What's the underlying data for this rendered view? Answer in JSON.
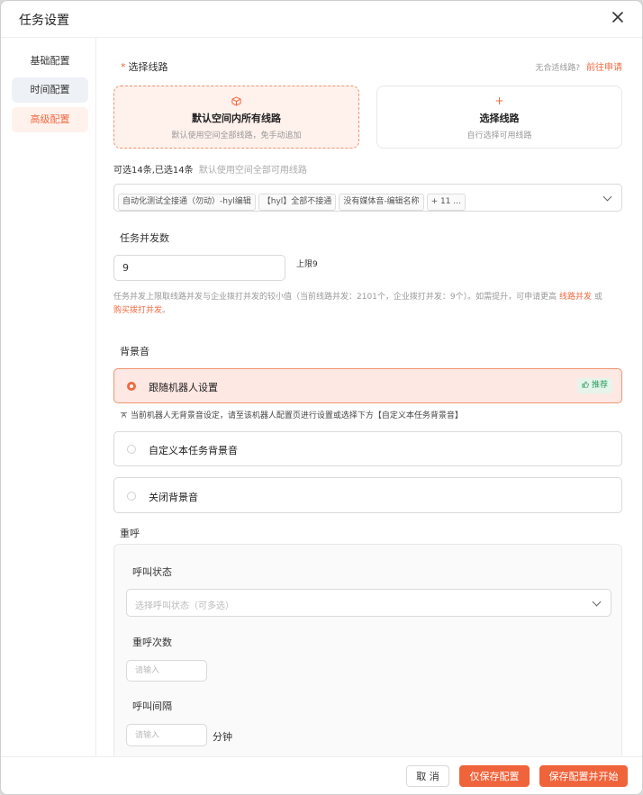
{
  "dialog": {
    "title": "任务设置"
  },
  "sidebar": {
    "items": [
      {
        "label": "基础配置"
      },
      {
        "label": "时间配置"
      },
      {
        "label": "高级配置"
      }
    ]
  },
  "lines": {
    "label": "选择线路",
    "no_fit": "无合适线路?",
    "apply_link": "前往申请",
    "card_all": {
      "title": "默认空间内所有线路",
      "desc": "默认使用空间全部线路，免手动追加"
    },
    "card_select": {
      "icon": "+",
      "title": "选择线路",
      "desc": "自行选择可用线路"
    },
    "count_text": "可选14条,已选14条",
    "count_hint": "默认使用空间全部可用线路",
    "tags": [
      "自动化测试全接通（勿动）-hyl编辑",
      "【hyl】全部不接通",
      "没有媒体音-编辑名称",
      "+ 11 ..."
    ]
  },
  "concurrency": {
    "label": "任务并发数",
    "value": "9",
    "limit": "上限9",
    "hint_prefix": "任务并发上限取线路并发与企业拨打并发的较小值（当前线路并发：2101个，企业拨打并发：9个）。如需提升，可申请更高",
    "hint_link1": "线路并发",
    "hint_or": "或",
    "hint_link2": "购买拨打并发",
    "hint_end": "。"
  },
  "bg_sound": {
    "label": "背景音",
    "options": [
      {
        "label": "跟随机器人设置",
        "selected": true,
        "badge": "推荐"
      },
      {
        "label": "自定义本任务背景音",
        "selected": false
      },
      {
        "label": "关闭背景音",
        "selected": false
      }
    ],
    "notice": "当前机器人无背景音设定，请至该机器人配置页进行设置或选择下方【自定义本任务背景音】"
  },
  "redial": {
    "label": "重呼",
    "call_status": {
      "label": "呼叫状态",
      "placeholder": "选择呼叫状态（可多选）"
    },
    "times": {
      "label": "重呼次数",
      "placeholder": "请输入"
    },
    "interval": {
      "label": "呼叫间隔",
      "placeholder": "请输入",
      "unit": "分钟"
    }
  },
  "footer": {
    "cancel": "取 消",
    "save_only": "仅保存配置",
    "save_start": "保存配置并开始"
  },
  "colors": {
    "accent": "#f06a41",
    "accent_bg": "#fff1ec",
    "success": "#2e9a5b"
  }
}
